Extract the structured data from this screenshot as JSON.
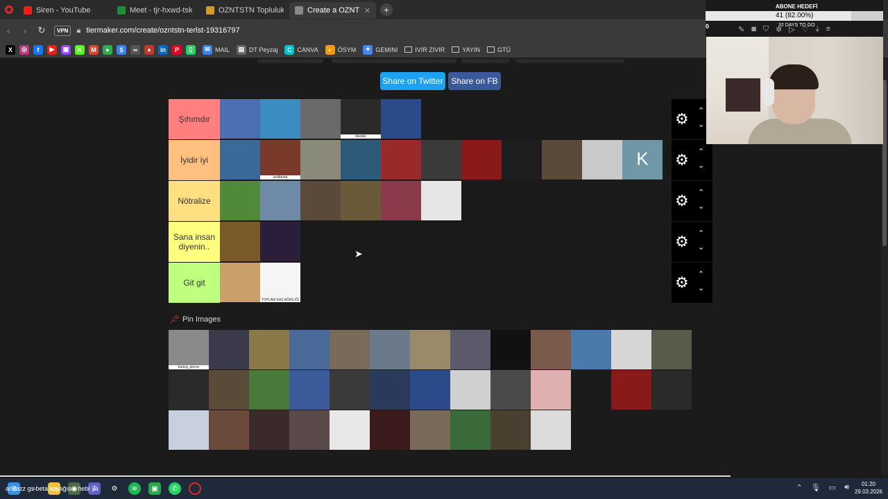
{
  "browser": {
    "tabs": [
      {
        "label": "Siren - YouTube",
        "favicon_color": "#e62117",
        "active": false
      },
      {
        "label": "Meet - tjr-hxwd-tsk",
        "favicon_color": "#1e8e3e",
        "active": false
      },
      {
        "label": "OZNTSTN Topluluk - Tier L",
        "favicon_color": "#d49a2a",
        "active": false
      },
      {
        "label": "Create a OZNTSTN TİERLİS",
        "favicon_color": "#888888",
        "active": true
      }
    ],
    "new_tab": "+",
    "vpn": "VPN",
    "url": "tiermaker.com/create/ozntstn-terlst-19316797"
  },
  "bookmarks": [
    {
      "label": "",
      "icon": "x-icon",
      "color": "#000000",
      "glyph": "X"
    },
    {
      "label": "",
      "icon": "instagram-icon",
      "color": "#c13584",
      "glyph": "◎"
    },
    {
      "label": "",
      "icon": "facebook-icon",
      "color": "#1877f2",
      "glyph": "f"
    },
    {
      "label": "",
      "icon": "youtube-icon",
      "color": "#e62117",
      "glyph": "▶"
    },
    {
      "label": "",
      "icon": "twitch-icon",
      "color": "#9146ff",
      "glyph": "▣"
    },
    {
      "label": "",
      "icon": "kick-icon",
      "color": "#53fc18",
      "glyph": "K"
    },
    {
      "label": "",
      "icon": "gmail-icon",
      "color": "#d44638",
      "glyph": "M"
    },
    {
      "label": "",
      "icon": "maps-icon",
      "color": "#34a853",
      "glyph": "●"
    },
    {
      "label": "",
      "icon": "dollar-icon",
      "color": "#3b82f6",
      "glyph": "$"
    },
    {
      "label": "",
      "icon": "link-icon",
      "color": "#555555",
      "glyph": "∞"
    },
    {
      "label": "",
      "icon": "drop-icon",
      "color": "#c0392b",
      "glyph": "♦"
    },
    {
      "label": "",
      "icon": "linkedin-icon",
      "color": "#0a66c2",
      "glyph": "in"
    },
    {
      "label": "",
      "icon": "pinterest-icon",
      "color": "#e60023",
      "glyph": "P"
    },
    {
      "label": "",
      "icon": "phone-icon",
      "color": "#25d366",
      "glyph": "▯"
    },
    {
      "label": "MAIL",
      "icon": "mail-icon",
      "color": "#3b82f6",
      "glyph": "✉"
    },
    {
      "label": "DT Peyzaj",
      "icon": "dt-icon",
      "color": "#666666",
      "glyph": "▤"
    },
    {
      "label": "CANVA",
      "icon": "canva-icon",
      "color": "#00c4cc",
      "glyph": "C"
    },
    {
      "label": "ÖSYM",
      "icon": "osym-icon",
      "color": "#f39c12",
      "glyph": "◐"
    },
    {
      "label": "GEMINI",
      "icon": "gemini-icon",
      "color": "#4285f4",
      "glyph": "✦"
    },
    {
      "label": "IVIR ZIVIR",
      "icon": "folder-icon",
      "color": "",
      "glyph": ""
    },
    {
      "label": "YAYIN",
      "icon": "folder-icon",
      "color": "",
      "glyph": ""
    },
    {
      "label": "GTÜ",
      "icon": "folder-icon",
      "color": "",
      "glyph": ""
    }
  ],
  "share": {
    "twitter": "Share on Twitter",
    "facebook": "Share on FB",
    "twitter_color": "#1da1f2",
    "facebook_color": "#3b5998"
  },
  "tiers": [
    {
      "label": "Şıhımdır",
      "color": "#ff7f7f",
      "items": [
        {
          "caption": "",
          "color": "#4a6fb5"
        },
        {
          "caption": "",
          "color": "#3c8cc4"
        },
        {
          "caption": "",
          "color": "#6a6a6a"
        },
        {
          "caption": "dianike",
          "color": "#2a2a2a"
        },
        {
          "caption": "",
          "color": "#2b4a8a"
        }
      ]
    },
    {
      "label": "İyidir iyi",
      "color": "#ffbf7f",
      "items": [
        {
          "caption": "",
          "color": "#3b6a9a"
        },
        {
          "caption": "asdbeaat",
          "color": "#7a3a2a"
        },
        {
          "caption": "",
          "color": "#8a8a7a"
        },
        {
          "caption": "",
          "color": "#2e5a7a"
        },
        {
          "caption": "",
          "color": "#9a2a2a"
        },
        {
          "caption": "",
          "color": "#3a3a3a"
        },
        {
          "caption": "",
          "color": "#8a1a1a"
        },
        {
          "caption": "",
          "color": "#1e1e1e"
        },
        {
          "caption": "",
          "color": "#5a4a3a"
        },
        {
          "caption": "",
          "color": "#c9c9c9"
        },
        {
          "caption": "K",
          "color": "#6f97a6"
        }
      ]
    },
    {
      "label": "Nötralize",
      "color": "#ffdf7f",
      "items": [
        {
          "caption": "",
          "color": "#4e8a3a"
        },
        {
          "caption": "",
          "color": "#6e8aa6"
        },
        {
          "caption": "",
          "color": "#5a4a3a"
        },
        {
          "caption": "",
          "color": "#6a5a3a"
        },
        {
          "caption": "",
          "color": "#8a3a4a"
        },
        {
          "caption": "",
          "color": "#e6e6e6"
        }
      ]
    },
    {
      "label": "Sana insan diyenin..",
      "color": "#ffff7f",
      "items": [
        {
          "caption": "",
          "color": "#7a5a2a"
        },
        {
          "caption": "",
          "color": "#2a1e3a"
        }
      ]
    },
    {
      "label": "Git git",
      "color": "#bfff7f",
      "items": [
        {
          "caption": "",
          "color": "#c9a06a"
        },
        {
          "caption": "TOPLAM KAS AĞIRLIĞI",
          "color": "#f5f5f5"
        }
      ]
    }
  ],
  "pin": {
    "title": "Pin Images",
    "rows": [
      [
        {
          "caption": "kartop_pierce",
          "color": "#8a8a8a"
        },
        {
          "caption": "",
          "color": "#3a3a4a"
        },
        {
          "caption": "",
          "color": "#8a7a4a"
        },
        {
          "caption": "",
          "color": "#4a6a9a"
        },
        {
          "caption": "",
          "color": "#7a6a5a"
        },
        {
          "caption": "",
          "color": "#6a7a8a"
        },
        {
          "caption": "",
          "color": "#9a8a6a"
        },
        {
          "caption": "",
          "color": "#5a5a6a"
        },
        {
          "caption": "",
          "color": "#111111"
        },
        {
          "caption": "",
          "color": "#7a5a4a"
        },
        {
          "caption": "",
          "color": "#4a7aaa"
        },
        {
          "caption": "",
          "color": "#d6d6d6"
        },
        {
          "caption": "",
          "color": "#5a5a4a"
        }
      ],
      [
        {
          "caption": "",
          "color": "#2a2a2a"
        },
        {
          "caption": "",
          "color": "#5a4a3a"
        },
        {
          "caption": "",
          "color": "#4a7a3a"
        },
        {
          "caption": "",
          "color": "#3a5a9a"
        },
        {
          "caption": "",
          "color": "#3a3a3a"
        },
        {
          "caption": "",
          "color": "#2a3a5a"
        },
        {
          "caption": "",
          "color": "#2a4a8a"
        },
        {
          "caption": "",
          "color": "#d0d0d0"
        },
        {
          "caption": "",
          "color": "#4a4a4a"
        },
        {
          "caption": "",
          "color": "#e0b0b0"
        },
        {
          "caption": "",
          "color": "#1a1a1a"
        },
        {
          "caption": "",
          "color": "#8a1a1a"
        },
        {
          "caption": "",
          "color": "#2a2a2a"
        }
      ],
      [
        {
          "caption": "",
          "color": "#c8d0e0"
        },
        {
          "caption": "",
          "color": "#6a4a3a"
        },
        {
          "caption": "",
          "color": "#3a2a2a"
        },
        {
          "caption": "",
          "color": "#5a4a4a"
        },
        {
          "caption": "",
          "color": "#e8e8e8"
        },
        {
          "caption": "",
          "color": "#3a1a1a"
        },
        {
          "caption": "",
          "color": "#7a6a5a"
        },
        {
          "caption": "",
          "color": "#3a6a3a"
        },
        {
          "caption": "",
          "color": "#4a4030"
        },
        {
          "caption": "",
          "color": "#dcdcdc"
        }
      ]
    ]
  },
  "overlay": {
    "abone_label": "ABONE HEDEFİ",
    "abone_value": "41 (82.00%)",
    "abone_percent": 82,
    "abone_zero": "0",
    "days": "32 DAYS TO GO"
  },
  "taskbar": {
    "overlay_text": "ar cazz gs beta kuyağısın hebi ya",
    "time": "01:20",
    "date": "29.03.2026"
  }
}
